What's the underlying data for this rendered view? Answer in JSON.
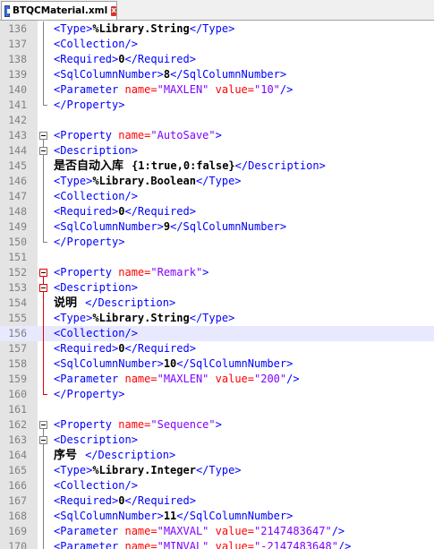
{
  "tab": {
    "label": "BTQCMaterial.xml",
    "close_symbol": "x"
  },
  "current_line": 156,
  "lines": [
    {
      "n": "136",
      "fold": "v",
      "parts": [
        [
          "tag",
          "<Type>"
        ],
        [
          "txt",
          "%Library.String"
        ],
        [
          "tag",
          "</Type>"
        ]
      ]
    },
    {
      "n": "137",
      "fold": "v",
      "parts": [
        [
          "tag",
          "<Collection/>"
        ]
      ]
    },
    {
      "n": "138",
      "fold": "v",
      "parts": [
        [
          "tag",
          "<Required>"
        ],
        [
          "txt",
          "0"
        ],
        [
          "tag",
          "</Required>"
        ]
      ]
    },
    {
      "n": "139",
      "fold": "v",
      "parts": [
        [
          "tag",
          "<SqlColumnNumber>"
        ],
        [
          "txt",
          "8"
        ],
        [
          "tag",
          "</SqlColumnNumber>"
        ]
      ]
    },
    {
      "n": "140",
      "fold": "v",
      "parts": [
        [
          "tag",
          "<Parameter "
        ],
        [
          "attr",
          "name="
        ],
        [
          "val",
          "\"MAXLEN\""
        ],
        [
          "tag",
          " "
        ],
        [
          "attr",
          "value="
        ],
        [
          "val",
          "\"10\""
        ],
        [
          "tag",
          "/>"
        ]
      ]
    },
    {
      "n": "141",
      "fold": "end",
      "parts": [
        [
          "tag",
          "</Property>"
        ]
      ]
    },
    {
      "n": "142",
      "fold": "",
      "parts": []
    },
    {
      "n": "143",
      "fold": "open",
      "parts": [
        [
          "tag",
          "<Property "
        ],
        [
          "attr",
          "name="
        ],
        [
          "val",
          "\"AutoSave\""
        ],
        [
          "tag",
          ">"
        ]
      ]
    },
    {
      "n": "144",
      "fold": "open",
      "parts": [
        [
          "tag",
          "<Description>"
        ]
      ]
    },
    {
      "n": "145",
      "fold": "v",
      "parts": [
        [
          "cjk",
          "是否自动入库  "
        ],
        [
          "txt",
          "{1:true,0:false}"
        ],
        [
          "tag",
          "</Description>"
        ]
      ]
    },
    {
      "n": "146",
      "fold": "v",
      "parts": [
        [
          "tag",
          "<Type>"
        ],
        [
          "txt",
          "%Library.Boolean"
        ],
        [
          "tag",
          "</Type>"
        ]
      ]
    },
    {
      "n": "147",
      "fold": "v",
      "parts": [
        [
          "tag",
          "<Collection/>"
        ]
      ]
    },
    {
      "n": "148",
      "fold": "v",
      "parts": [
        [
          "tag",
          "<Required>"
        ],
        [
          "txt",
          "0"
        ],
        [
          "tag",
          "</Required>"
        ]
      ]
    },
    {
      "n": "149",
      "fold": "v",
      "parts": [
        [
          "tag",
          "<SqlColumnNumber>"
        ],
        [
          "txt",
          "9"
        ],
        [
          "tag",
          "</SqlColumnNumber>"
        ]
      ]
    },
    {
      "n": "150",
      "fold": "end",
      "parts": [
        [
          "tag",
          "</Property>"
        ]
      ]
    },
    {
      "n": "151",
      "fold": "",
      "parts": []
    },
    {
      "n": "152",
      "fold": "open-red",
      "parts": [
        [
          "tag",
          "<Property "
        ],
        [
          "attr",
          "name="
        ],
        [
          "val",
          "\"Remark\""
        ],
        [
          "tag",
          ">"
        ]
      ]
    },
    {
      "n": "153",
      "fold": "open-red",
      "parts": [
        [
          "tag",
          "<Description>"
        ]
      ]
    },
    {
      "n": "154",
      "fold": "v-red",
      "parts": [
        [
          "cjk",
          "说明  "
        ],
        [
          "tag",
          "</Description>"
        ]
      ]
    },
    {
      "n": "155",
      "fold": "v-red",
      "parts": [
        [
          "tag",
          "<Type>"
        ],
        [
          "txt",
          "%Library.String"
        ],
        [
          "tag",
          "</Type>"
        ]
      ]
    },
    {
      "n": "156",
      "fold": "v-red",
      "parts": [
        [
          "tag",
          "<Collection/>"
        ]
      ]
    },
    {
      "n": "157",
      "fold": "v-red",
      "parts": [
        [
          "tag",
          "<Required>"
        ],
        [
          "txt",
          "0"
        ],
        [
          "tag",
          "</Required>"
        ]
      ]
    },
    {
      "n": "158",
      "fold": "v-red",
      "parts": [
        [
          "tag",
          "<SqlColumnNumber>"
        ],
        [
          "txt",
          "10"
        ],
        [
          "tag",
          "</SqlColumnNumber>"
        ]
      ]
    },
    {
      "n": "159",
      "fold": "v-red",
      "parts": [
        [
          "tag",
          "<Parameter "
        ],
        [
          "attr",
          "name="
        ],
        [
          "val",
          "\"MAXLEN\""
        ],
        [
          "tag",
          " "
        ],
        [
          "attr",
          "value="
        ],
        [
          "val",
          "\"200\""
        ],
        [
          "tag",
          "/>"
        ]
      ]
    },
    {
      "n": "160",
      "fold": "end-red",
      "parts": [
        [
          "tag",
          "</Property>"
        ]
      ]
    },
    {
      "n": "161",
      "fold": "",
      "parts": []
    },
    {
      "n": "162",
      "fold": "open",
      "parts": [
        [
          "tag",
          "<Property "
        ],
        [
          "attr",
          "name="
        ],
        [
          "val",
          "\"Sequence\""
        ],
        [
          "tag",
          ">"
        ]
      ]
    },
    {
      "n": "163",
      "fold": "open",
      "parts": [
        [
          "tag",
          "<Description>"
        ]
      ]
    },
    {
      "n": "164",
      "fold": "v",
      "parts": [
        [
          "cjk",
          "序号  "
        ],
        [
          "tag",
          "</Description>"
        ]
      ]
    },
    {
      "n": "165",
      "fold": "v",
      "parts": [
        [
          "tag",
          "<Type>"
        ],
        [
          "txt",
          "%Library.Integer"
        ],
        [
          "tag",
          "</Type>"
        ]
      ]
    },
    {
      "n": "166",
      "fold": "v",
      "parts": [
        [
          "tag",
          "<Collection/>"
        ]
      ]
    },
    {
      "n": "167",
      "fold": "v",
      "parts": [
        [
          "tag",
          "<Required>"
        ],
        [
          "txt",
          "0"
        ],
        [
          "tag",
          "</Required>"
        ]
      ]
    },
    {
      "n": "168",
      "fold": "v",
      "parts": [
        [
          "tag",
          "<SqlColumnNumber>"
        ],
        [
          "txt",
          "11"
        ],
        [
          "tag",
          "</SqlColumnNumber>"
        ]
      ]
    },
    {
      "n": "169",
      "fold": "v",
      "parts": [
        [
          "tag",
          "<Parameter "
        ],
        [
          "attr",
          "name="
        ],
        [
          "val",
          "\"MAXVAL\""
        ],
        [
          "tag",
          " "
        ],
        [
          "attr",
          "value="
        ],
        [
          "val",
          "\"2147483647\""
        ],
        [
          "tag",
          "/>"
        ]
      ]
    },
    {
      "n": "170",
      "fold": "v",
      "parts": [
        [
          "tag",
          "<Parameter "
        ],
        [
          "attr",
          "name="
        ],
        [
          "val",
          "\"MINVAL\""
        ],
        [
          "tag",
          " "
        ],
        [
          "attr",
          "value="
        ],
        [
          "val",
          "\"-2147483648\""
        ],
        [
          "tag",
          "/>"
        ]
      ]
    }
  ]
}
